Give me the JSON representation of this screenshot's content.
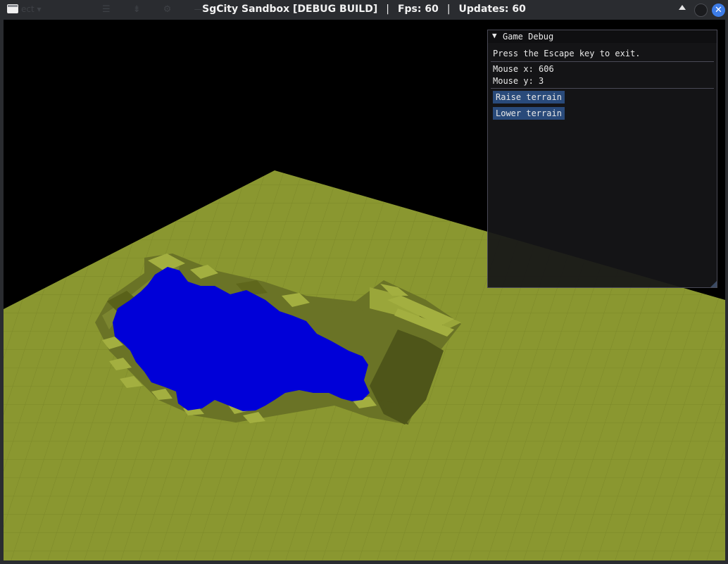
{
  "window": {
    "title": "SgCity Sandbox [DEBUG BUILD]",
    "separator": "|",
    "fps_label": "Fps: 60",
    "updates_label": "Updates: 60",
    "ghost_menu_label": "ect ▾",
    "ghost_tools": "☰ ⇟ ⚙ —",
    "controls": {
      "close_glyph": "✕"
    }
  },
  "debug_panel": {
    "collapse_glyph": "▼",
    "title": "Game Debug",
    "hint": "Press the Escape key to exit.",
    "mouse_x": "Mouse x: 606",
    "mouse_y": "Mouse y: 3",
    "raise_button": "Raise terrain",
    "lower_button": "Lower terrain"
  },
  "colors": {
    "terrain": "#8a9730",
    "terrain_dark": "#5c6420",
    "water": "#0000d8",
    "sky": "#000000",
    "button": "#294a7a"
  }
}
